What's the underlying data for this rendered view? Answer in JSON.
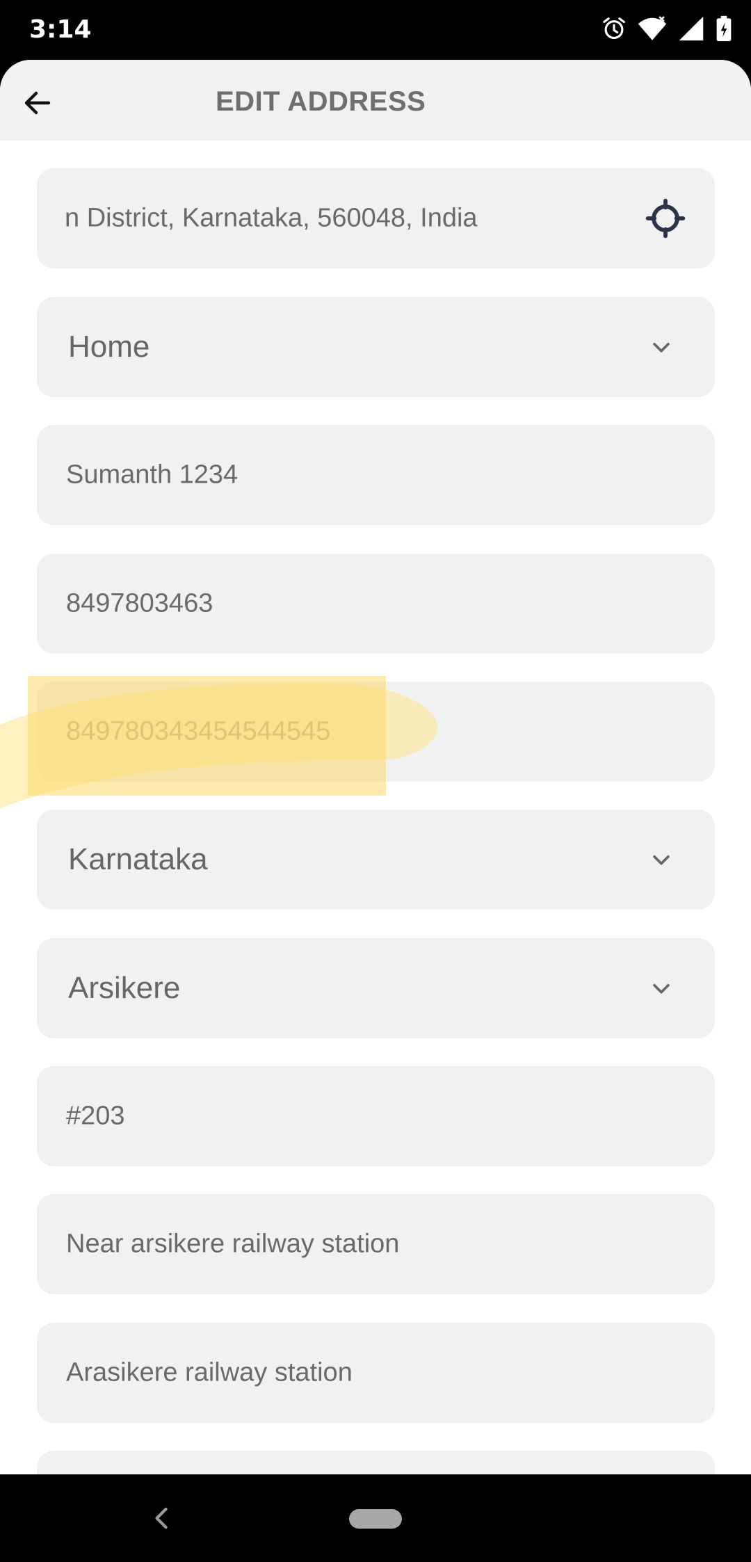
{
  "status_bar": {
    "time": "3:14",
    "icons": [
      "alarm-icon",
      "wifi-icon",
      "signal-icon",
      "battery-icon"
    ]
  },
  "header": {
    "title": "EDIT ADDRESS",
    "back_icon": "arrow-left-icon"
  },
  "form": {
    "location": {
      "value": "n District, Karnataka, 560048, India",
      "icon": "gps-target-icon"
    },
    "address_type": {
      "value": "Home",
      "icon": "chevron-down-icon"
    },
    "name": {
      "value": "Sumanth 1234"
    },
    "phone": {
      "value": "8497803463"
    },
    "alternate_phone": {
      "value": "849780343454544545"
    },
    "state": {
      "value": "Karnataka",
      "icon": "chevron-down-icon"
    },
    "city": {
      "value": "Arsikere",
      "icon": "chevron-down-icon"
    },
    "house_no": {
      "value": "#203"
    },
    "landmark": {
      "value": "Near arsikere railway station"
    },
    "area": {
      "value": "Arasikere railway station"
    }
  },
  "colors": {
    "field_bg": "#f1f1f1",
    "text": "#6a6a6a",
    "highlight": "#fde68a",
    "gps_icon": "#2b3448"
  }
}
